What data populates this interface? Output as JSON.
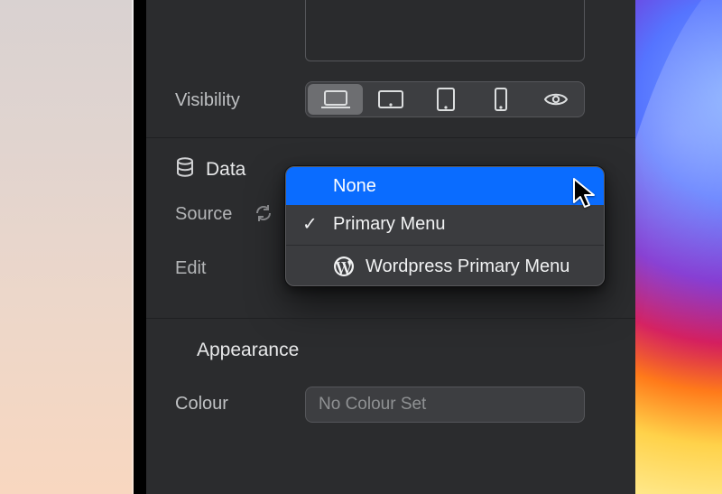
{
  "visibility": {
    "label": "Visibility"
  },
  "data_section": {
    "title": "Data",
    "source_label": "Source",
    "edit_label": "Edit"
  },
  "dropdown": {
    "none": "None",
    "primary": "Primary Menu",
    "wp": "Wordpress Primary Menu"
  },
  "appearance": {
    "title": "Appearance",
    "colour_label": "Colour",
    "colour_placeholder": "No Colour Set"
  }
}
